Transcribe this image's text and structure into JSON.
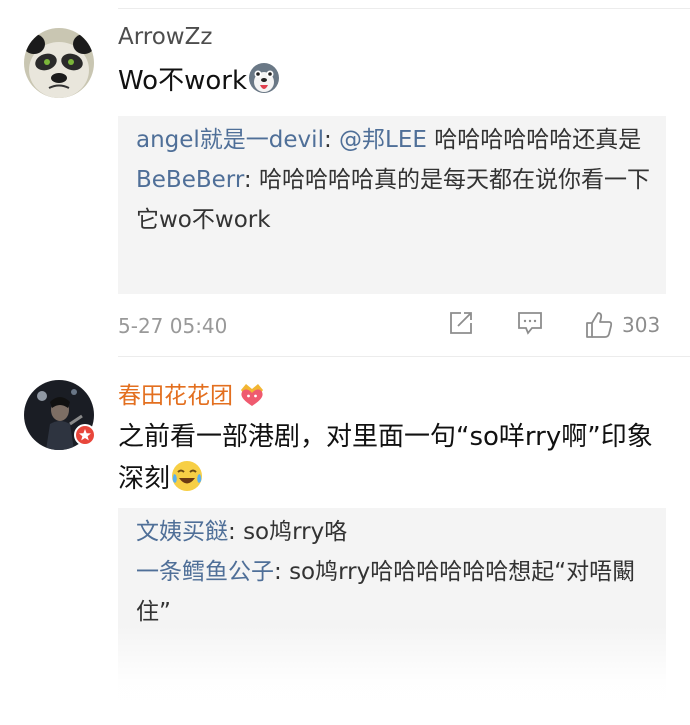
{
  "comments": [
    {
      "username": "ArrowZz",
      "avatar_icon": "kungfu-panda-avatar",
      "text": "Wo不work",
      "emoji": "husky-tongue-emoji",
      "replies": [
        {
          "name": "angel就是一devil",
          "sep": ": ",
          "text": "@邦LEE 哈哈哈哈哈哈还真是"
        },
        {
          "name": "BeBeBerr",
          "sep": ": ",
          "text": "哈哈哈哈哈真的是每天都在说你看一下它wo不work"
        }
      ],
      "time": "5-27 05:40",
      "likes": "303",
      "actions": [
        "share-icon",
        "comment-icon",
        "thumbs-up-icon"
      ]
    },
    {
      "username": "春田花花团",
      "avatar_icon": "concert-singer-avatar",
      "badge": "crown-heart-badge",
      "text": "之前看一部港剧，对里面一句“so咩rry啊”印象深刻",
      "emoji": "laughing-crying-emoji",
      "replies": [
        {
          "name": "文姨买餸",
          "sep": ": ",
          "text": "so鸠rry咯"
        },
        {
          "name": "一条鳕鱼公子",
          "sep": ": ",
          "text": "so鸠rry哈哈哈哈哈哈想起“对唔闞住”"
        }
      ]
    }
  ],
  "colors": {
    "reply_name": "#4f6f98",
    "highlight_username": "#e36f1f",
    "reply_bg": "#f4f4f4",
    "meta_gray": "#999999"
  }
}
